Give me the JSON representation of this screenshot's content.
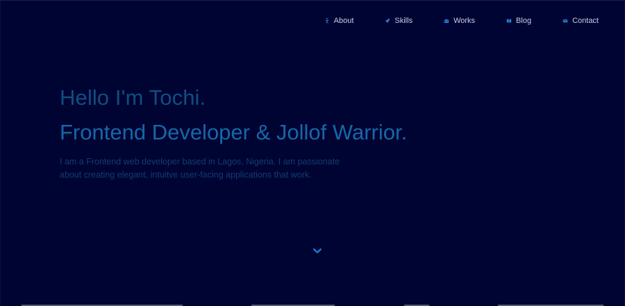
{
  "nav": {
    "items": [
      {
        "label": "About",
        "icon": "person-icon"
      },
      {
        "label": "Skills",
        "icon": "rocket-icon"
      },
      {
        "label": "Works",
        "icon": "briefcase-icon"
      },
      {
        "label": "Blog",
        "icon": "book-icon"
      },
      {
        "label": "Contact",
        "icon": "envelope-icon"
      }
    ]
  },
  "hero": {
    "greeting": "Hello I'm Tochi.",
    "role": "Frontend Developer & Jollof Warrior.",
    "intro": "I am a Frontend web developer based in Lagos, Nigeria. I am passionate about creating elegant, intuitve user-facing applications that work."
  },
  "scroll": {
    "icon": "chevron-down-icon"
  },
  "colors": {
    "background": "#000433",
    "nav_text": "#c7cde6",
    "nav_icon": "#2f7fd1",
    "greeting": "#0f4e80",
    "role": "#1667a8",
    "intro": "#123c6d",
    "chevron": "#1f78d1"
  }
}
